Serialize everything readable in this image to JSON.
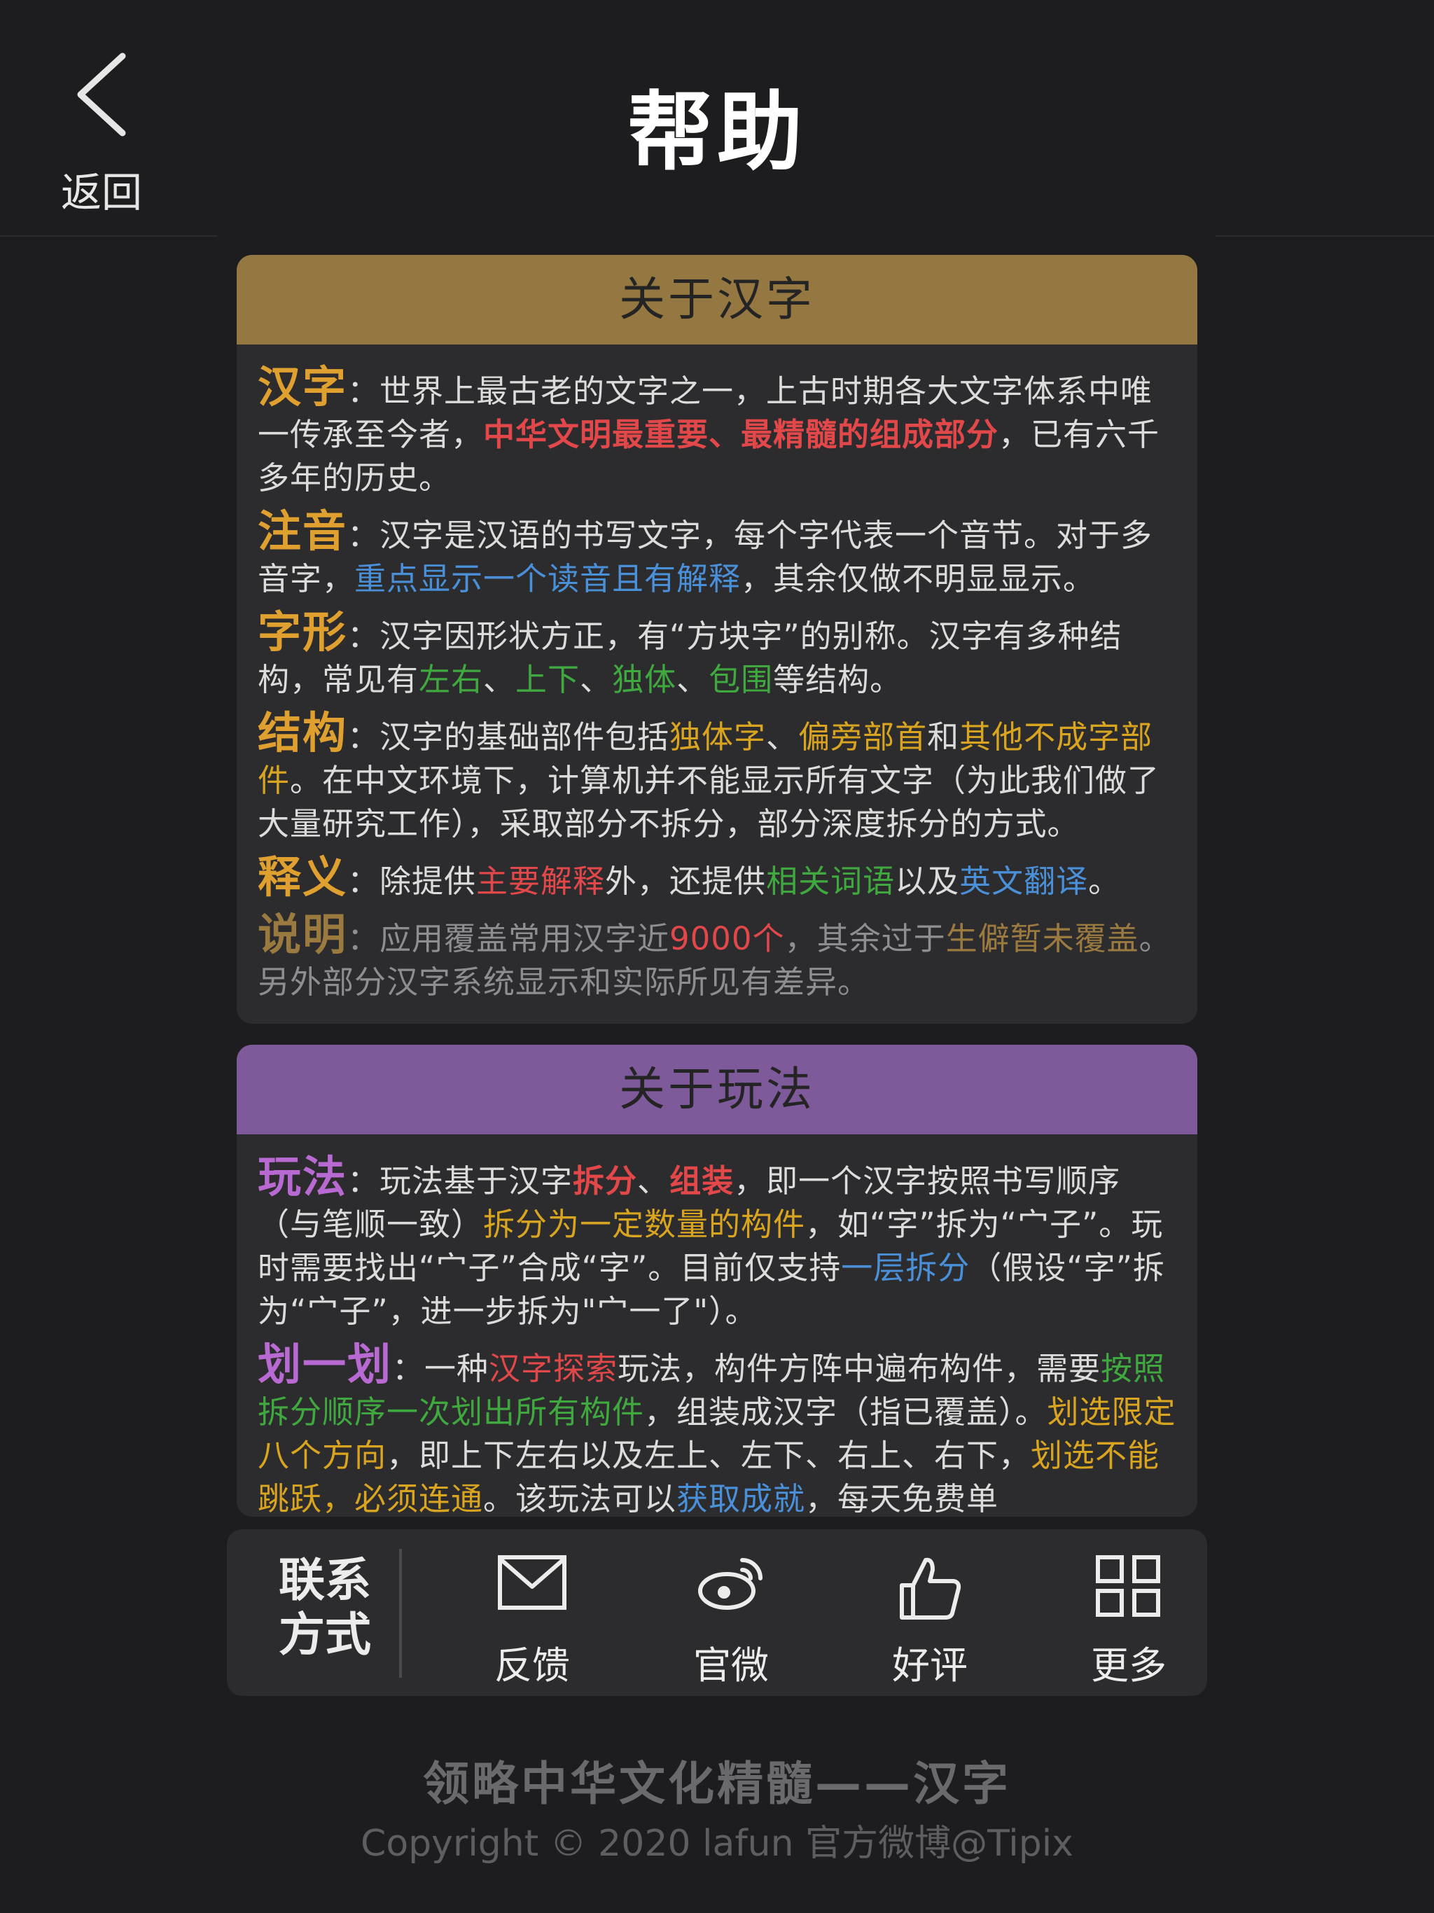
{
  "header": {
    "back_label": "返回",
    "title": "帮助"
  },
  "about_hanzi": {
    "title": "关于汉字",
    "header_color": "#957841",
    "p1": {
      "term": "汉字",
      "t1": "：世界上最古老的文字之一，上古时期各大文字体系中唯一传承至今者，",
      "h1": "中华文明最重要、最精髓的组成部分",
      "t2": "，已有六千多年的历史。"
    },
    "p2": {
      "term": "注音",
      "t1": "：汉字是汉语的书写文字，每个字代表一个音节。对于多音字，",
      "h1": "重点显示一个读音且有解释",
      "t2": "，其余仅做不明显显示。"
    },
    "p3": {
      "term": "字形",
      "t1": "：汉字因形状方正，有“方块字”的别称。汉字有多种结构，常见有",
      "h1": "左右",
      "s1": "、",
      "h2": "上下",
      "s2": "、",
      "h3": "独体",
      "s3": "、",
      "h4": "包围",
      "t2": "等结构。"
    },
    "p4": {
      "term": "结构",
      "t1": "：汉字的基础部件包括",
      "h1": "独体字",
      "s1": "、",
      "h2": "偏旁部首",
      "s2": "和",
      "h3": "其他不成字部件",
      "t2": "。在中文环境下，计算机并不能显示所有文字（为此我们做了大量研究工作），采取部分不拆分，部分深度拆分的方式。"
    },
    "p5": {
      "term": "释义",
      "t1": "：除提供",
      "h1": "主要解释",
      "s1": "外，还提供",
      "h2": "相关词语",
      "s2": "以及",
      "h3": "英文翻译",
      "t2": "。"
    },
    "p6": {
      "term": "说明",
      "t1": "：应用覆盖常用汉字近",
      "h1": "9000个",
      "s1": "，其余过于",
      "h2": "生僻暂未覆盖",
      "t2": "。另外部分汉字系统显示和实际所见有差异。"
    }
  },
  "about_play": {
    "title": "关于玩法",
    "header_color": "#7f5a9b",
    "p1": {
      "term": "玩法",
      "t1": "：玩法基于汉字",
      "h1": "拆分",
      "s1": "、",
      "h2": "组装",
      "s2": "，即一个汉字按照书写顺序（与笔顺一致）",
      "h3": "拆分为一定数量的构件",
      "s3": "，如“字”拆为“宀子”。玩时需要找出“宀子”合成“字”。目前仅支持",
      "h4": "一层拆分",
      "t2": "（假设“字”拆为“宀子”，进一步拆为\"宀一了\"）。"
    },
    "p2": {
      "term": "划一划",
      "t1": "：一种",
      "h1": "汉字探索",
      "s1": "玩法，构件方阵中遍布构件，需要",
      "h2": "按照拆分顺序一次划出所有构件",
      "s2": "，组装成汉字（指已覆盖）。",
      "h3": "划选限定八个方向",
      "s3": "，即上下左右以及左上、左下、右上、右下，",
      "h4": "划选不能跳跃，必须连通",
      "s4": "。该玩法可以",
      "h5": "获取成就",
      "t2": "，每天免费单"
    }
  },
  "contact": {
    "title_line1": "联系",
    "title_line2": "方式",
    "items": [
      {
        "label": "反馈",
        "icon": "mail-icon"
      },
      {
        "label": "官微",
        "icon": "weibo-icon"
      },
      {
        "label": "好评",
        "icon": "thumbs-up-icon"
      },
      {
        "label": "更多",
        "icon": "grid-icon"
      }
    ]
  },
  "footer": {
    "slogan": "领略中华文化精髓——汉字",
    "copyright": "Copyright © 2020  lafun 官方微博@Tipix"
  }
}
